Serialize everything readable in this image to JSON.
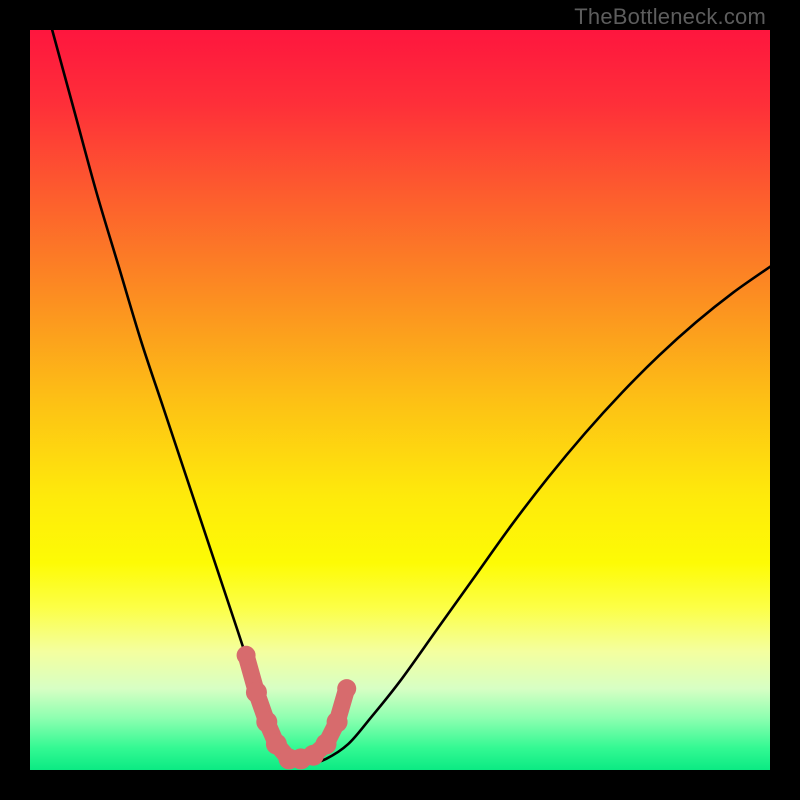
{
  "watermark": "TheBottleneck.com",
  "colors": {
    "frame": "#000000",
    "curve": "#000000",
    "markers_fill": "#d76b6d",
    "markers_stroke": "#d76b6d",
    "gradient_stops": [
      {
        "offset": 0.0,
        "color": "#fe163e"
      },
      {
        "offset": 0.1,
        "color": "#fe2f39"
      },
      {
        "offset": 0.22,
        "color": "#fd5c2e"
      },
      {
        "offset": 0.35,
        "color": "#fc8a22"
      },
      {
        "offset": 0.5,
        "color": "#fdc015"
      },
      {
        "offset": 0.63,
        "color": "#feea0b"
      },
      {
        "offset": 0.72,
        "color": "#fdfb05"
      },
      {
        "offset": 0.78,
        "color": "#fcff46"
      },
      {
        "offset": 0.84,
        "color": "#f4ff9f"
      },
      {
        "offset": 0.89,
        "color": "#d7ffc4"
      },
      {
        "offset": 0.93,
        "color": "#8dffb0"
      },
      {
        "offset": 0.97,
        "color": "#34f993"
      },
      {
        "offset": 1.0,
        "color": "#0bea83"
      }
    ]
  },
  "chart_data": {
    "type": "line",
    "title": "",
    "xlabel": "",
    "ylabel": "",
    "xlim": [
      0,
      100
    ],
    "ylim": [
      0,
      100
    ],
    "grid": false,
    "legend": false,
    "series": [
      {
        "name": "bottleneck-curve",
        "x": [
          3,
          6,
          9,
          12,
          15,
          18,
          21,
          24,
          26,
          28,
          30,
          31.5,
          33,
          34.5,
          36,
          38,
          40,
          43,
          46,
          50,
          55,
          60,
          65,
          70,
          75,
          80,
          85,
          90,
          95,
          100
        ],
        "y": [
          100,
          89,
          78,
          68,
          58,
          49,
          40,
          31,
          25,
          19,
          13,
          9,
          5.5,
          3,
          1.5,
          1,
          1.5,
          3.5,
          7,
          12,
          19,
          26,
          33,
          39.5,
          45.5,
          51,
          56,
          60.5,
          64.5,
          68
        ]
      }
    ],
    "markers": {
      "name": "optimal-region",
      "x": [
        29.2,
        30.6,
        32.0,
        33.3,
        35.0,
        36.6,
        38.3,
        40.0,
        41.5,
        42.8
      ],
      "y": [
        15.5,
        10.5,
        6.5,
        3.5,
        1.5,
        1.5,
        2.0,
        3.5,
        6.5,
        11.0
      ]
    }
  }
}
